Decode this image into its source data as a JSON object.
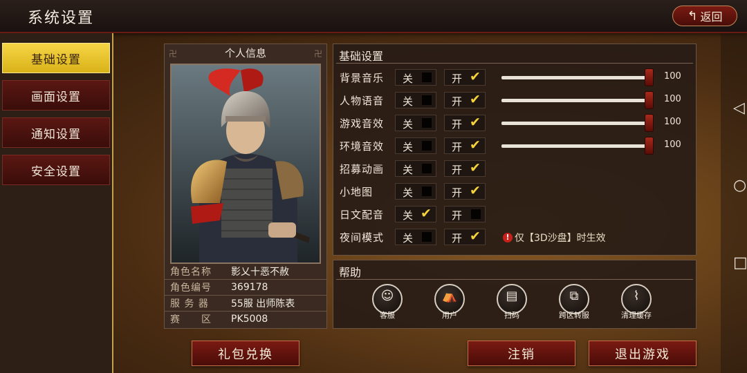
{
  "header": {
    "title": "系统设置",
    "back_label": "返回"
  },
  "sidebar": {
    "items": [
      {
        "label": "基础设置",
        "active": true
      },
      {
        "label": "画面设置",
        "active": false
      },
      {
        "label": "通知设置",
        "active": false
      },
      {
        "label": "安全设置",
        "active": false
      }
    ]
  },
  "profile": {
    "title": "个人信息",
    "rows": [
      {
        "label": "角色名称",
        "value": "影乂十恶不赦"
      },
      {
        "label": "角色编号",
        "value": "369178"
      },
      {
        "label": "服 务 器",
        "value": "55服 出师陈表"
      },
      {
        "label": "赛　　区",
        "value": "PK5008"
      }
    ]
  },
  "basic_settings": {
    "title": "基础设置",
    "off_label": "关",
    "on_label": "开",
    "rows": [
      {
        "name": "背景音乐",
        "state": "on",
        "volume": 100
      },
      {
        "name": "人物语音",
        "state": "on",
        "volume": 100
      },
      {
        "name": "游戏音效",
        "state": "on",
        "volume": 100
      },
      {
        "name": "环境音效",
        "state": "on",
        "volume": 100
      },
      {
        "name": "招募动画",
        "state": "on"
      },
      {
        "name": "小地图",
        "state": "on"
      },
      {
        "name": "日文配音",
        "state": "off"
      },
      {
        "name": "夜间模式",
        "state": "on",
        "note": "仅【3D沙盘】时生效"
      }
    ]
  },
  "help": {
    "title": "帮助",
    "items": [
      {
        "label": "客服",
        "icon": "customer-service-icon"
      },
      {
        "label": "用户",
        "icon": "user-tent-icon"
      },
      {
        "label": "扫码",
        "icon": "scan-icon"
      },
      {
        "label": "跨区转服",
        "icon": "server-transfer-icon"
      },
      {
        "label": "清理缓存",
        "icon": "broom-icon"
      }
    ]
  },
  "buttons": {
    "gift": "礼包兑换",
    "logout": "注销",
    "exit": "退出游戏"
  },
  "colors": {
    "accent": "#f4d23a",
    "button_red": "#7a1a12",
    "active_menu": "#f6d545"
  }
}
